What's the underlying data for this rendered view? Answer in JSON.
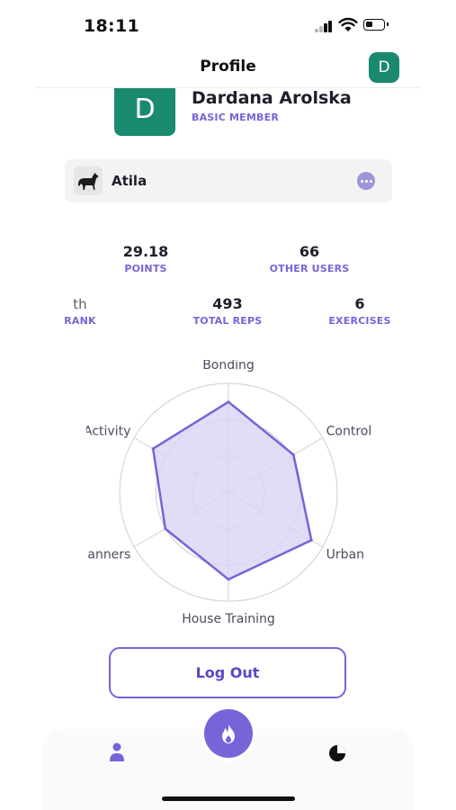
{
  "status_bar": {
    "time": "18:11"
  },
  "header": {
    "title": "Profile",
    "avatar_letter": "D"
  },
  "profile": {
    "avatar_letter": "D",
    "name": "Dardana Arolska",
    "membership": "BASIC MEMBER"
  },
  "dog": {
    "name": "Atila",
    "icon": "dog-icon",
    "menu_icon": "more-dots-icon"
  },
  "stats": {
    "points": {
      "value": "29.18",
      "label": "POINTS"
    },
    "other_users": {
      "value": "66",
      "label": "OTHER USERS"
    },
    "rank": {
      "value": "th",
      "label": "RANK"
    },
    "total_reps": {
      "value": "493",
      "label": "TOTAL REPS"
    },
    "exercises": {
      "value": "6",
      "label": "EXERCISES"
    }
  },
  "chart_data": {
    "type": "radar",
    "axes": [
      "Bonding",
      "Control",
      "Urban",
      "House Training",
      "Manners",
      "Activity"
    ],
    "values": [
      0.83,
      0.69,
      0.88,
      0.8,
      0.67,
      0.8
    ],
    "rlim": [
      0,
      1
    ],
    "rings": 3,
    "fill_color": "#d9d4f5",
    "stroke_color": "#7863d8"
  },
  "logout": {
    "label": "Log Out"
  },
  "tab_bar": {
    "items": [
      {
        "name": "Profile",
        "icon": "person-icon",
        "active": true
      },
      {
        "name": "Train",
        "icon": "flame-icon"
      },
      {
        "name": "Stats",
        "icon": "pie-chart-icon"
      }
    ]
  },
  "colors": {
    "accent": "#7863d8",
    "avatar_green": "#1a8a6e",
    "card_bg": "#f3f3f4"
  }
}
